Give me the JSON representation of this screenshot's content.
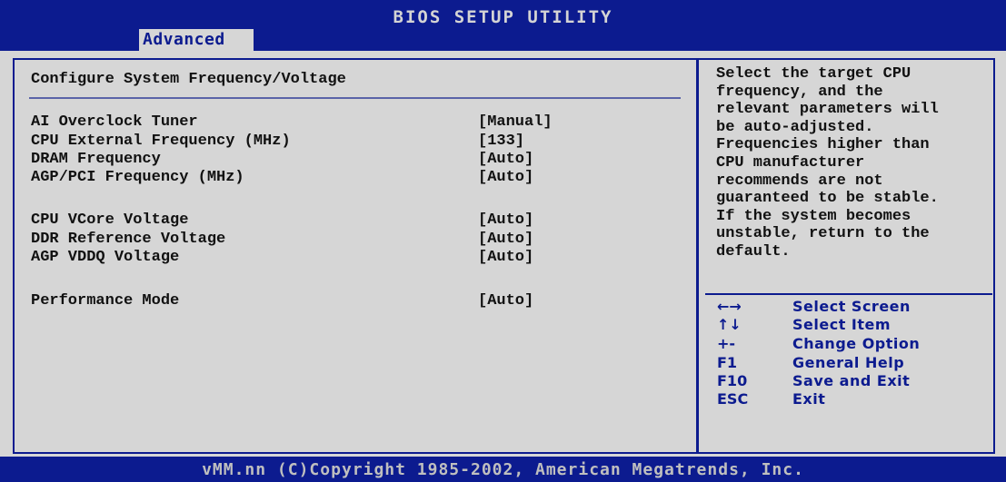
{
  "header": {
    "title": "BIOS SETUP UTILITY",
    "active_tab": "Advanced"
  },
  "main": {
    "section_title": "Configure System Frequency/Voltage",
    "settings": [
      {
        "label": "AI Overclock Tuner",
        "value": "[Manual]"
      },
      {
        "label": "CPU External Frequency (MHz)",
        "value": "[133]"
      },
      {
        "label": "DRAM Frequency",
        "value": "[Auto]"
      },
      {
        "label": "AGP/PCI Frequency (MHz)",
        "value": "[Auto]"
      },
      {
        "label": "CPU VCore Voltage",
        "value": "[Auto]"
      },
      {
        "label": "DDR Reference Voltage",
        "value": "[Auto]"
      },
      {
        "label": "AGP VDDQ Voltage",
        "value": "[Auto]"
      },
      {
        "label": "Performance Mode",
        "value": "[Auto]"
      }
    ]
  },
  "help": {
    "lines": [
      "Select the target CPU",
      "frequency, and the",
      "relevant parameters will",
      "be auto-adjusted.",
      "Frequencies higher than",
      "CPU manufacturer",
      "recommends are not",
      "guaranteed to be stable.",
      "If the system becomes",
      "unstable, return to the",
      "default."
    ],
    "keys": [
      {
        "key": "←→",
        "action": "Select Screen"
      },
      {
        "key": "↑↓",
        "action": "Select Item"
      },
      {
        "key": "+-",
        "action": "Change Option"
      },
      {
        "key": "F1",
        "action": "General Help"
      },
      {
        "key": "F10",
        "action": "Save and Exit"
      },
      {
        "key": "ESC",
        "action": "Exit"
      }
    ]
  },
  "footer": {
    "text": "vMM.nn (C)Copyright 1985-2002, American Megatrends, Inc."
  },
  "colors": {
    "bios_blue": "#0c1b8f",
    "bios_gray": "#d6d6d6",
    "text_dark": "#111111"
  }
}
